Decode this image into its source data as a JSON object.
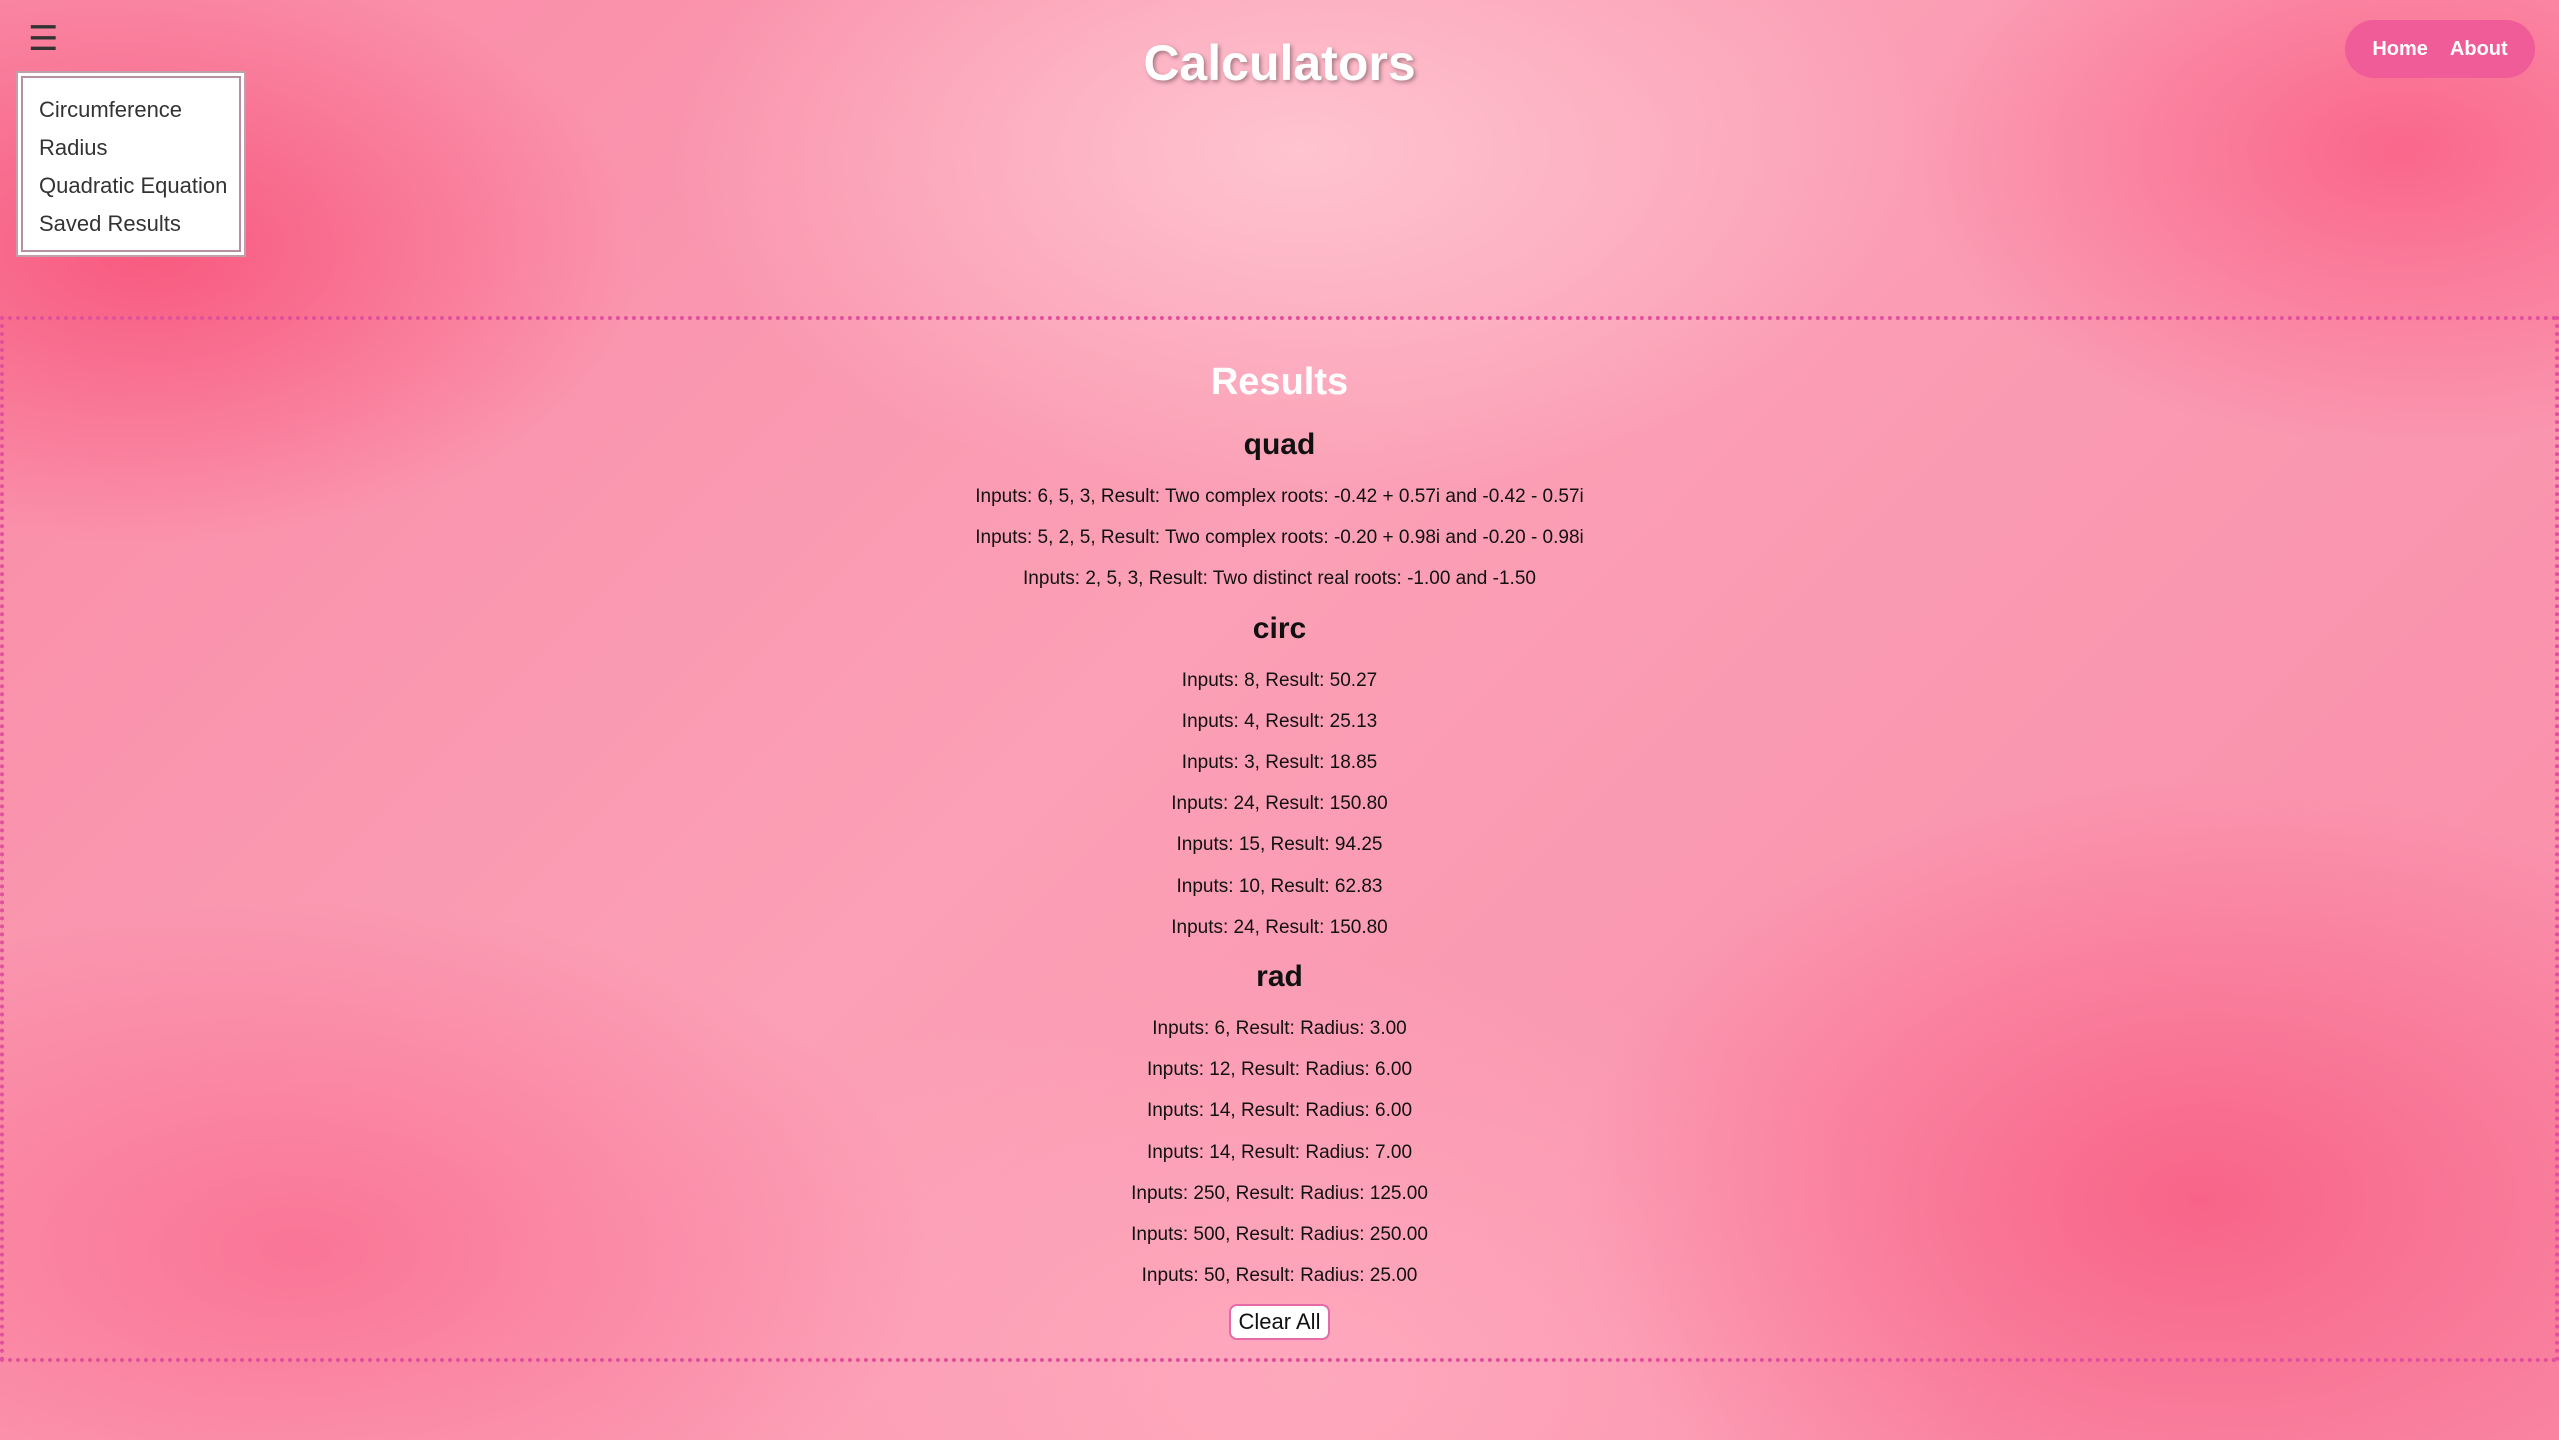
{
  "header": {
    "menu_icon": "hamburger-icon",
    "menu_glyph": "☰",
    "title": "Calculators"
  },
  "dropdown": {
    "items": [
      {
        "label": "Circumference"
      },
      {
        "label": "Radius"
      },
      {
        "label": "Quadratic Equation"
      },
      {
        "label": "Saved Results"
      }
    ]
  },
  "nav": {
    "home": "Home",
    "about": "About"
  },
  "results": {
    "title": "Results",
    "groups": [
      {
        "name": "quad",
        "entries": [
          "Inputs: 6, 5, 3, Result: Two complex roots: -0.42 + 0.57i and -0.42 - 0.57i",
          "Inputs: 5, 2, 5, Result: Two complex roots: -0.20 + 0.98i and -0.20 - 0.98i",
          "Inputs: 2, 5, 3, Result: Two distinct real roots: -1.00 and -1.50"
        ]
      },
      {
        "name": "circ",
        "entries": [
          "Inputs: 8, Result: 50.27",
          "Inputs: 4, Result: 25.13",
          "Inputs: 3, Result: 18.85",
          "Inputs: 24, Result: 150.80",
          "Inputs: 15, Result: 94.25",
          "Inputs: 10, Result: 62.83",
          "Inputs: 24, Result: 150.80"
        ]
      },
      {
        "name": "rad",
        "entries": [
          "Inputs: 6, Result: Radius: 3.00",
          "Inputs: 12, Result: Radius: 6.00",
          "Inputs: 14, Result: Radius: 6.00",
          "Inputs: 14, Result: Radius: 7.00",
          "Inputs: 250, Result: Radius: 125.00",
          "Inputs: 500, Result: Radius: 250.00",
          "Inputs: 50, Result: Radius: 25.00"
        ]
      }
    ],
    "clear_label": "Clear All"
  },
  "colors": {
    "accent": "#ef5c98",
    "panel_border": "#e0509c",
    "background": "#fba0b6"
  }
}
